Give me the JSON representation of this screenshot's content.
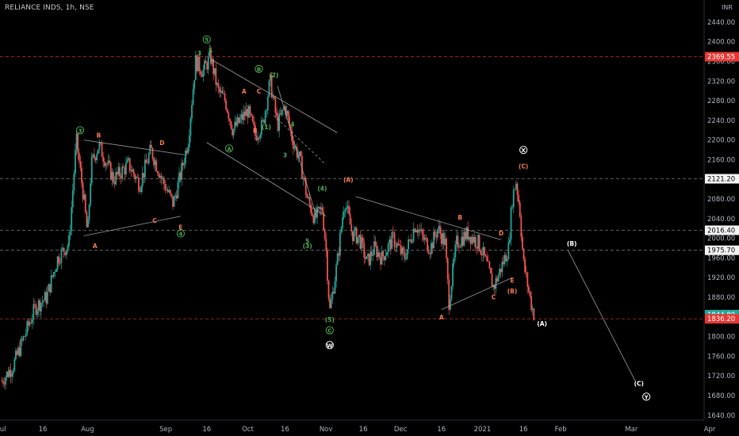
{
  "header": {
    "title": "RELIANCE INDS, 1h, NSE"
  },
  "chart_data": {
    "type": "candlestick",
    "symbol": "RELIANCE INDS",
    "interval": "1h",
    "exchange": "NSE",
    "currency": "INR",
    "y_ticks": [
      1640,
      1680,
      1720,
      1760,
      1800,
      1840,
      1880,
      1920,
      1960,
      2000,
      2040,
      2080,
      2120,
      2160,
      2200,
      2240,
      2280,
      2320,
      2360,
      2400,
      2440,
      2480
    ],
    "y_tick_labels": [
      "1640.00",
      "1680.00",
      "1720.00",
      "1760.00",
      "1800.00",
      "1840.00",
      "1880.00",
      "1920.00",
      "1960.00",
      "2000.00",
      "2040.00",
      "2080.00",
      "2120.00",
      "2160.00",
      "2200.00",
      "2240.00",
      "2280.00",
      "2320.00",
      "2360.00",
      "2400.00",
      "2440.00",
      "2480.00"
    ],
    "ylim": [
      1630,
      2485
    ],
    "x_ticks": [
      {
        "label": "Jul",
        "t": 0
      },
      {
        "label": "16",
        "t": 11
      },
      {
        "label": "Aug",
        "t": 23
      },
      {
        "label": "Sep",
        "t": 44
      },
      {
        "label": "16",
        "t": 55
      },
      {
        "label": "Oct",
        "t": 66
      },
      {
        "label": "16",
        "t": 76
      },
      {
        "label": "Nov",
        "t": 87
      },
      {
        "label": "16",
        "t": 97
      },
      {
        "label": "Dec",
        "t": 107
      },
      {
        "label": "16",
        "t": 118
      },
      {
        "label": "2021",
        "t": 129
      },
      {
        "label": "16",
        "t": 140
      },
      {
        "label": "Feb",
        "t": 150
      },
      {
        "label": "Mar",
        "t": 169
      },
      {
        "label": "Apr",
        "t": 190
      }
    ],
    "xlim": [
      -0.5,
      188.5
    ],
    "price_levels": [
      {
        "value": 2369.55,
        "label": "2369.55",
        "color": "#e53935",
        "style": "red-dashed",
        "tag": "red"
      },
      {
        "value": 2121.2,
        "label": "2121.20",
        "color": "#9e9e9e",
        "style": "gray-dashed",
        "tag": "white"
      },
      {
        "value": 2016.4,
        "label": "2016.40",
        "color": "#9e9e9e",
        "style": "gray-dashed",
        "tag": "white"
      },
      {
        "value": 1975.7,
        "label": "1975.70",
        "color": "#9e9e9e",
        "style": "gray-dashed",
        "tag": "white"
      },
      {
        "value": 1844.8,
        "label": "1844.80",
        "color": "#26a69a",
        "style": "none",
        "tag": "teal"
      },
      {
        "value": 1836.2,
        "label": "1836.20",
        "color": "#e53935",
        "style": "red-dashed",
        "tag": "red"
      }
    ],
    "close_path": [
      [
        0,
        1710
      ],
      [
        3,
        1740
      ],
      [
        6,
        1800
      ],
      [
        9,
        1860
      ],
      [
        12,
        1880
      ],
      [
        15,
        1960
      ],
      [
        18,
        1990
      ],
      [
        20,
        2200
      ],
      [
        22,
        2080
      ],
      [
        23,
        2005
      ],
      [
        24,
        2150
      ],
      [
        26,
        2190
      ],
      [
        30,
        2120
      ],
      [
        34,
        2150
      ],
      [
        37,
        2110
      ],
      [
        40,
        2180
      ],
      [
        43,
        2120
      ],
      [
        46,
        2070
      ],
      [
        48,
        2130
      ],
      [
        50,
        2200
      ],
      [
        52,
        2360
      ],
      [
        54,
        2340
      ],
      [
        56,
        2370
      ],
      [
        58,
        2300
      ],
      [
        60,
        2280
      ],
      [
        62,
        2220
      ],
      [
        64,
        2240
      ],
      [
        66,
        2260
      ],
      [
        68,
        2210
      ],
      [
        70,
        2230
      ],
      [
        72,
        2320
      ],
      [
        74,
        2230
      ],
      [
        76,
        2270
      ],
      [
        78,
        2200
      ],
      [
        80,
        2160
      ],
      [
        82,
        2080
      ],
      [
        84,
        2040
      ],
      [
        86,
        2060
      ],
      [
        87,
        1980
      ],
      [
        88,
        1850
      ],
      [
        90,
        1950
      ],
      [
        92,
        2080
      ],
      [
        94,
        2010
      ],
      [
        96,
        2000
      ],
      [
        98,
        1950
      ],
      [
        100,
        1980
      ],
      [
        102,
        1960
      ],
      [
        105,
        2000
      ],
      [
        108,
        1960
      ],
      [
        111,
        2030
      ],
      [
        113,
        2000
      ],
      [
        115,
        1980
      ],
      [
        117,
        2020
      ],
      [
        119,
        1990
      ],
      [
        120,
        1870
      ],
      [
        122,
        1990
      ],
      [
        125,
        2010
      ],
      [
        128,
        1990
      ],
      [
        130,
        1950
      ],
      [
        132,
        1900
      ],
      [
        134,
        1940
      ],
      [
        136,
        1980
      ],
      [
        137,
        2080
      ],
      [
        138,
        2118
      ],
      [
        139,
        2060
      ],
      [
        140,
        1950
      ],
      [
        141,
        1910
      ],
      [
        142,
        1870
      ],
      [
        143,
        1840
      ]
    ],
    "trendlines": [
      {
        "from": [
          22,
          2200
        ],
        "to": [
          49,
          2170
        ]
      },
      {
        "from": [
          22,
          2005
        ],
        "to": [
          48,
          2045
        ]
      },
      {
        "from": [
          56,
          2365
        ],
        "to": [
          90,
          2215
        ]
      },
      {
        "from": [
          55,
          2195
        ],
        "to": [
          87,
          2045
        ]
      },
      {
        "from": [
          74,
          2310
        ],
        "to": [
          84,
          2055
        ]
      },
      {
        "from": [
          73,
          2250
        ],
        "to": [
          87,
          2150
        ],
        "dashed": true
      },
      {
        "from": [
          95,
          2085
        ],
        "to": [
          134,
          1997
        ]
      },
      {
        "from": [
          118,
          1855
        ],
        "to": [
          137,
          1920
        ]
      },
      {
        "from": [
          152,
          1975
        ],
        "to": [
          170,
          1710
        ]
      }
    ],
    "wave_labels": [
      {
        "text": "3",
        "t": 21,
        "v": 2215,
        "color": "#4caf50",
        "circled": true
      },
      {
        "text": "B",
        "t": 26,
        "v": 2205,
        "color": "#f57c50"
      },
      {
        "text": "A",
        "t": 25,
        "v": 1980,
        "color": "#f57c50"
      },
      {
        "text": "D",
        "t": 43,
        "v": 2190,
        "color": "#f57c50"
      },
      {
        "text": "C",
        "t": 41,
        "v": 2032,
        "color": "#f57c50"
      },
      {
        "text": "E",
        "t": 48,
        "v": 2018,
        "color": "#f57c50"
      },
      {
        "text": "4",
        "t": 48,
        "v": 2005,
        "color": "#4caf50",
        "circled": true
      },
      {
        "text": "5",
        "t": 55,
        "v": 2400,
        "color": "#4caf50",
        "circled": true
      },
      {
        "text": "3",
        "t": 53,
        "v": 2372,
        "color": "#4caf50"
      },
      {
        "text": "5",
        "t": 56,
        "v": 2378,
        "color": "#4caf50"
      },
      {
        "text": "B",
        "t": 69,
        "v": 2340,
        "color": "#4caf50",
        "circled": true
      },
      {
        "text": "C",
        "t": 69,
        "v": 2295,
        "color": "#f57c50"
      },
      {
        "text": "A",
        "t": 65,
        "v": 2295,
        "color": "#f57c50"
      },
      {
        "text": "B",
        "t": 68,
        "v": 2215,
        "color": "#f57c50"
      },
      {
        "text": "A",
        "t": 61,
        "v": 2178,
        "color": "#4caf50",
        "circled": true
      },
      {
        "text": "(1)",
        "t": 71,
        "v": 2222,
        "color": "#4caf50"
      },
      {
        "text": "(2)",
        "t": 73,
        "v": 2328,
        "color": "#4caf50"
      },
      {
        "text": "4",
        "t": 78,
        "v": 2228,
        "color": "#4caf50"
      },
      {
        "text": "3",
        "t": 76,
        "v": 2165,
        "color": "#4caf50"
      },
      {
        "text": "(4)",
        "t": 86,
        "v": 2097,
        "color": "#4caf50"
      },
      {
        "text": "(A)",
        "t": 93,
        "v": 2115,
        "color": "#f57c50"
      },
      {
        "text": "5",
        "t": 82,
        "v": 1990,
        "color": "#4caf50"
      },
      {
        "text": "(3)",
        "t": 82,
        "v": 1980,
        "color": "#4caf50"
      },
      {
        "text": "(5)",
        "t": 88,
        "v": 1830,
        "color": "#4caf50"
      },
      {
        "text": "C",
        "t": 88,
        "v": 1808,
        "color": "#4caf50",
        "circled": true
      },
      {
        "text": "W",
        "t": 88,
        "v": 1778,
        "color": "#ffffff",
        "circled": true
      },
      {
        "text": "B",
        "t": 123,
        "v": 2038,
        "color": "#f57c50"
      },
      {
        "text": "A",
        "t": 118,
        "v": 1835,
        "color": "#f57c50"
      },
      {
        "text": "D",
        "t": 134,
        "v": 2006,
        "color": "#f57c50"
      },
      {
        "text": "E",
        "t": 137,
        "v": 1910,
        "color": "#f57c50"
      },
      {
        "text": "C",
        "t": 132,
        "v": 1876,
        "color": "#f57c50"
      },
      {
        "text": "(B)",
        "t": 137,
        "v": 1888,
        "color": "#f57c50"
      },
      {
        "text": "X",
        "t": 140,
        "v": 2175,
        "color": "#ffffff",
        "circled": true
      },
      {
        "text": "(C)",
        "t": 140,
        "v": 2142,
        "color": "#f57c50"
      },
      {
        "text": "(A)",
        "t": 145,
        "v": 1822,
        "color": "#ffffff"
      },
      {
        "text": "(B)",
        "t": 153,
        "v": 1985,
        "color": "#ffffff"
      },
      {
        "text": "(C)",
        "t": 171,
        "v": 1700,
        "color": "#ffffff"
      },
      {
        "text": "Y",
        "t": 173,
        "v": 1673,
        "color": "#ffffff",
        "circled": true
      }
    ],
    "grid": false,
    "axis_label": "INR"
  },
  "colors": {
    "background": "#000000",
    "up": "#26a69a",
    "down": "#ef5350",
    "axis_text": "#b2b5be",
    "axis_line": "#2a2e39"
  }
}
